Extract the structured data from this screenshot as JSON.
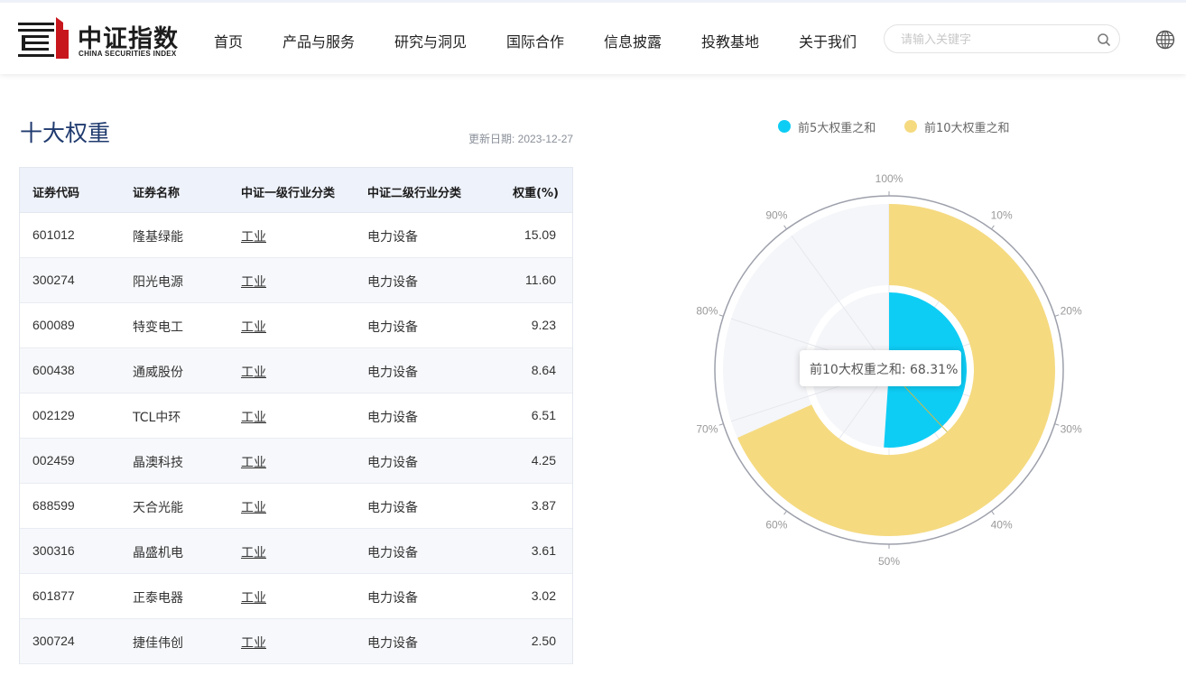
{
  "header": {
    "logo_cn": "中证指数",
    "logo_en": "CHINA SECURITIES INDEX",
    "nav": [
      "首页",
      "产品与服务",
      "研究与洞见",
      "国际合作",
      "信息披露",
      "投教基地",
      "关于我们"
    ],
    "search_placeholder": "请输入关键字"
  },
  "section": {
    "title": "十大权重",
    "update_label": "更新日期: ",
    "update_date": "2023-12-27"
  },
  "table": {
    "headers": [
      "证券代码",
      "证券名称",
      "中证一级行业分类",
      "中证二级行业分类",
      "权重(%)"
    ],
    "rows": [
      [
        "601012",
        "隆基绿能",
        "工业",
        "电力设备",
        "15.09"
      ],
      [
        "300274",
        "阳光电源",
        "工业",
        "电力设备",
        "11.60"
      ],
      [
        "600089",
        "特变电工",
        "工业",
        "电力设备",
        "9.23"
      ],
      [
        "600438",
        "通威股份",
        "工业",
        "电力设备",
        "8.64"
      ],
      [
        "002129",
        "TCL中环",
        "工业",
        "电力设备",
        "6.51"
      ],
      [
        "002459",
        "晶澳科技",
        "工业",
        "电力设备",
        "4.25"
      ],
      [
        "688599",
        "天合光能",
        "工业",
        "电力设备",
        "3.87"
      ],
      [
        "300316",
        "晶盛机电",
        "工业",
        "电力设备",
        "3.61"
      ],
      [
        "601877",
        "正泰电器",
        "工业",
        "电力设备",
        "3.02"
      ],
      [
        "300724",
        "捷佳伟创",
        "工业",
        "电力设备",
        "2.50"
      ]
    ]
  },
  "chart_data": {
    "type": "polar-bar",
    "series": [
      {
        "name": "前5大权重之和",
        "value": 51.07,
        "color": "#0ecdf5"
      },
      {
        "name": "前10大权重之和",
        "value": 68.31,
        "color": "#f5da80"
      }
    ],
    "angle_axis": {
      "labels": [
        "100%",
        "10%",
        "20%",
        "30%",
        "40%",
        "50%",
        "60%",
        "70%",
        "80%",
        "90%"
      ],
      "max": 100
    },
    "tooltip": {
      "label": "前10大权重之和: ",
      "value": "68.31%"
    }
  },
  "colors": {
    "title": "#1f3a6e",
    "logo_red": "#c8161d",
    "inner_bar": "#0ecdf5",
    "outer_bar": "#f5da80"
  }
}
